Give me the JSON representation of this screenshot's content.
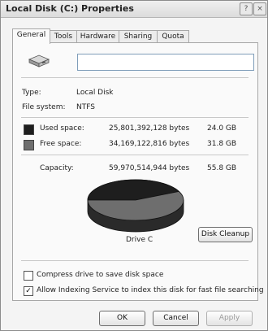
{
  "window": {
    "title": "Local Disk (C:) Properties",
    "help_glyph": "?",
    "close_glyph": "×"
  },
  "tabs": [
    "General",
    "Tools",
    "Hardware",
    "Sharing",
    "Quota"
  ],
  "general": {
    "volume_label_value": "",
    "type_label": "Type:",
    "type_value": "Local Disk",
    "fs_label": "File system:",
    "fs_value": "NTFS",
    "used_label": "Used space:",
    "used_bytes": "25,801,392,128 bytes",
    "used_gb": "24.0 GB",
    "free_label": "Free space:",
    "free_bytes": "34,169,122,816 bytes",
    "free_gb": "31.8 GB",
    "capacity_label": "Capacity:",
    "capacity_bytes": "59,970,514,944 bytes",
    "capacity_gb": "55.8 GB",
    "used_fraction": 0.43,
    "used_color": "#1e1e1e",
    "free_color": "#6e6e6e",
    "drive_caption": "Drive C",
    "disk_cleanup_label": "Disk Cleanup",
    "compress_label": "Compress drive to save disk space",
    "compress_checked": false,
    "indexing_label": "Allow Indexing Service to index this disk for fast file searching",
    "indexing_checked": true
  },
  "buttons": {
    "ok": "OK",
    "cancel": "Cancel",
    "apply": "Apply"
  }
}
